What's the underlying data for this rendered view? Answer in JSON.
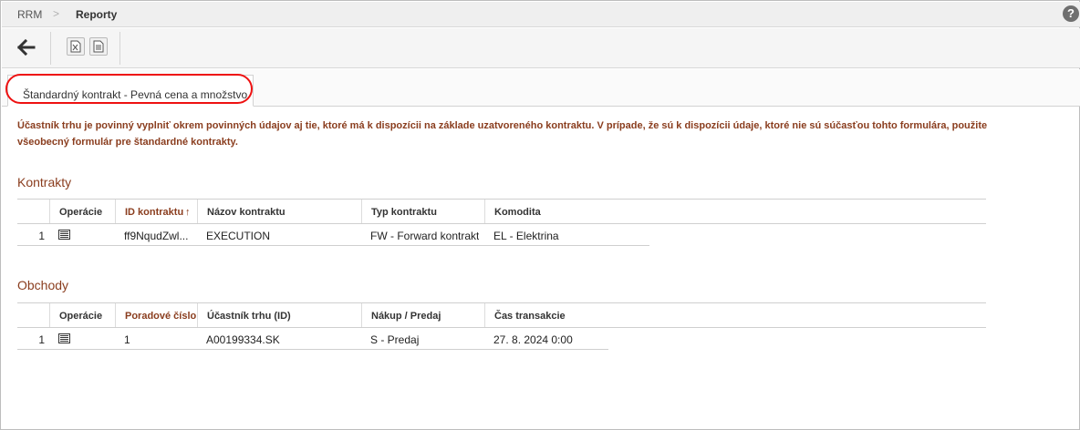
{
  "breadcrumb": {
    "root": "RRM",
    "separator": ">",
    "current": "Reporty"
  },
  "help": {
    "glyph": "?"
  },
  "tab": {
    "label": "Štandardný kontrakt - Pevná cena a množstvo"
  },
  "notice": "Účastník trhu je povinný vyplniť okrem povinných údajov aj tie, ktoré má k dispozícii na základe uzatvoreného kontraktu. V prípade, že sú k dispozícii údaje, ktoré nie sú súčasťou tohto formulára, použite všeobecný formulár pre štandardné kontrakty.",
  "contracts": {
    "title": "Kontrakty",
    "headers": [
      "Operácie",
      "ID kontraktu",
      "Názov kontraktu",
      "Typ kontraktu",
      "Komodita"
    ],
    "sort_indicator": "↑",
    "rows": [
      {
        "num": "1",
        "id": "ff9NqudZwl...",
        "name": "EXECUTION",
        "type": "FW - Forward kontrakt",
        "commodity": "EL - Elektrina"
      }
    ]
  },
  "trades": {
    "title": "Obchody",
    "headers": [
      "Operácie",
      "Poradové číslo",
      "Účastník trhu (ID)",
      "Nákup / Predaj",
      "Čas transakcie"
    ],
    "rows": [
      {
        "num": "1",
        "seq": "1",
        "participant": "A00199334.SK",
        "side": "S - Predaj",
        "time": "27. 8. 2024 0:00"
      }
    ]
  },
  "colors": {
    "accent": "#8a3d1e",
    "highlight": "#e11111"
  }
}
